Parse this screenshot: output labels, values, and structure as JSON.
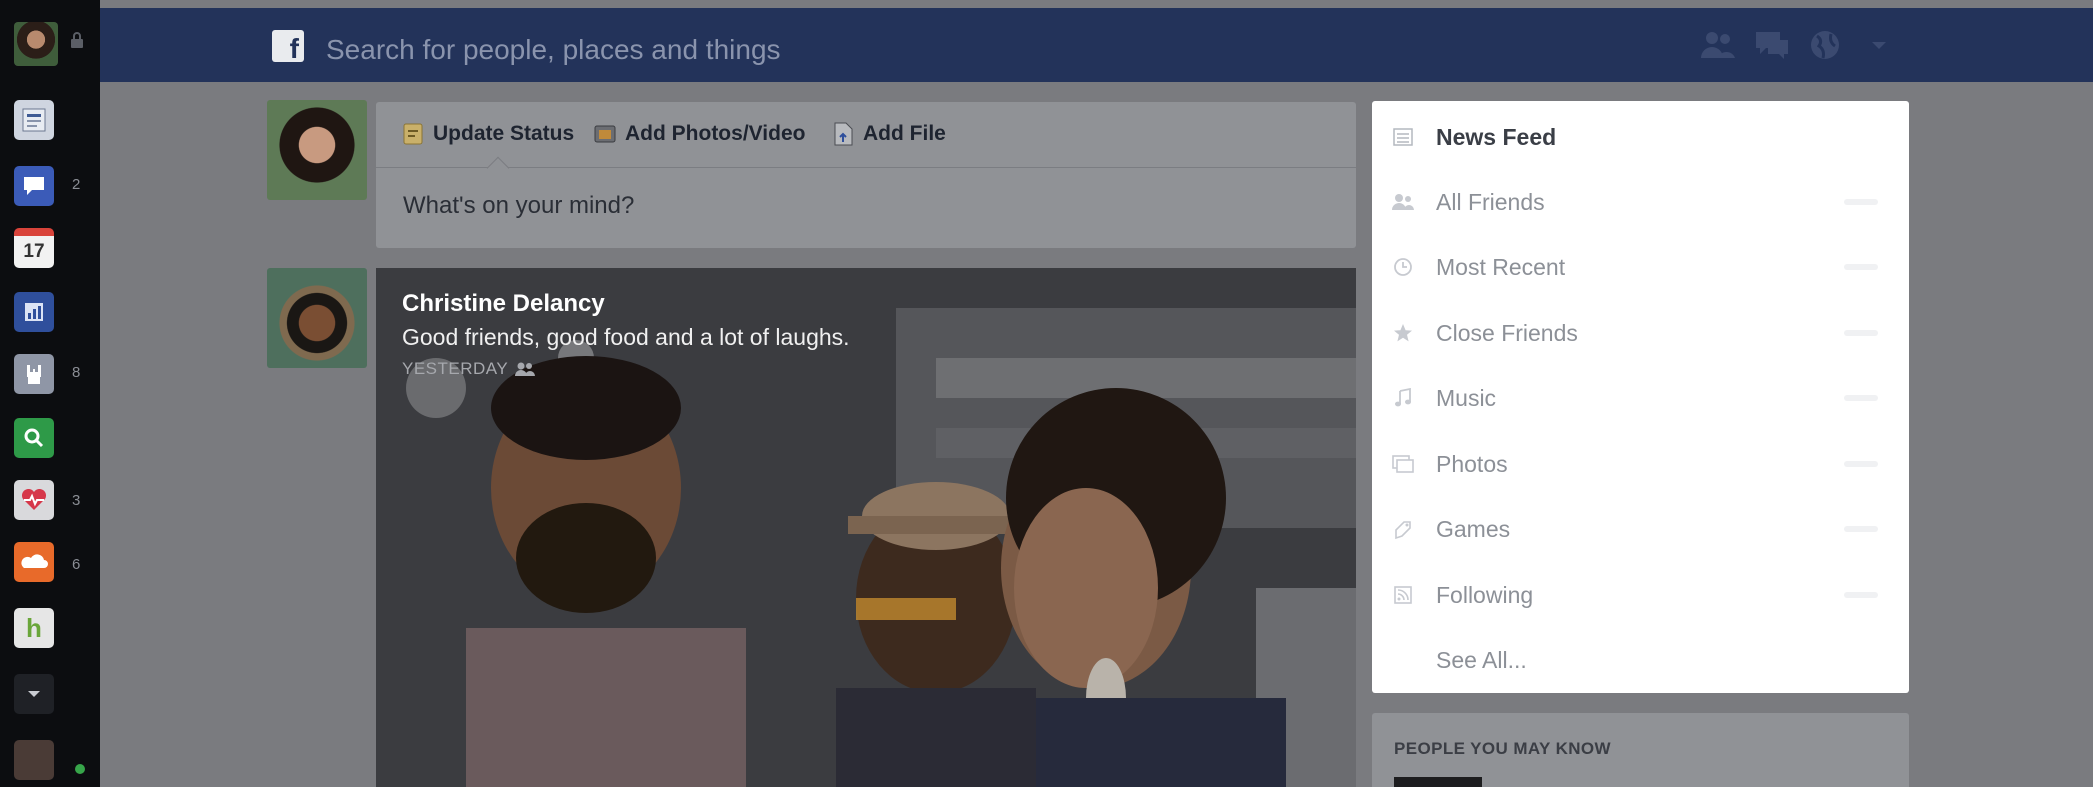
{
  "left_rail": {
    "apps": [
      {
        "icon": "newsfeed-icon",
        "badge": ""
      },
      {
        "icon": "messages-icon",
        "badge": "2"
      },
      {
        "icon": "calendar-icon",
        "label": "17",
        "badge": ""
      },
      {
        "icon": "chart-app-icon",
        "badge": ""
      },
      {
        "icon": "rock-hand-app-icon",
        "badge": "8"
      },
      {
        "icon": "search-app-icon",
        "badge": ""
      },
      {
        "icon": "heart-app-icon",
        "badge": "3"
      },
      {
        "icon": "soundcloud-icon",
        "badge": "6"
      },
      {
        "icon": "houzz-app-icon",
        "label": "h",
        "badge": ""
      },
      {
        "icon": "chevron-down-icon",
        "badge": ""
      }
    ]
  },
  "topbar": {
    "search_placeholder": "Search for people, places and things",
    "logo_letter": "f",
    "icons": [
      "friend-requests-icon",
      "messages-icon",
      "notifications-globe-icon",
      "dropdown-arrow-icon"
    ],
    "color": "#23335a"
  },
  "composer": {
    "tabs": [
      {
        "label": "Update Status",
        "icon": "status-icon"
      },
      {
        "label": "Add Photos/Video",
        "icon": "photo-icon"
      },
      {
        "label": "Add File",
        "icon": "file-icon"
      }
    ],
    "placeholder": "What's on your mind?"
  },
  "story": {
    "author": "Christine Delancy",
    "caption": "Good friends, good food and a lot of laughs.",
    "time": "YESTERDAY",
    "audience_icon": "friends-audience-icon"
  },
  "feed_menu": {
    "items": [
      {
        "label": "News Feed",
        "icon": "news-feed-icon",
        "active": true
      },
      {
        "label": "All Friends",
        "icon": "friends-icon",
        "active": false
      },
      {
        "label": "Most Recent",
        "icon": "clock-icon",
        "active": false
      },
      {
        "label": "Close Friends",
        "icon": "star-icon",
        "active": false
      },
      {
        "label": "Music",
        "icon": "music-note-icon",
        "active": false
      },
      {
        "label": "Photos",
        "icon": "photos-icon",
        "active": false
      },
      {
        "label": "Games",
        "icon": "games-icon",
        "active": false
      },
      {
        "label": "Following",
        "icon": "rss-feed-icon",
        "active": false
      },
      {
        "label": "See All...",
        "icon": "",
        "active": false
      }
    ]
  },
  "people_you_may_know": {
    "title": "PEOPLE YOU MAY KNOW"
  }
}
